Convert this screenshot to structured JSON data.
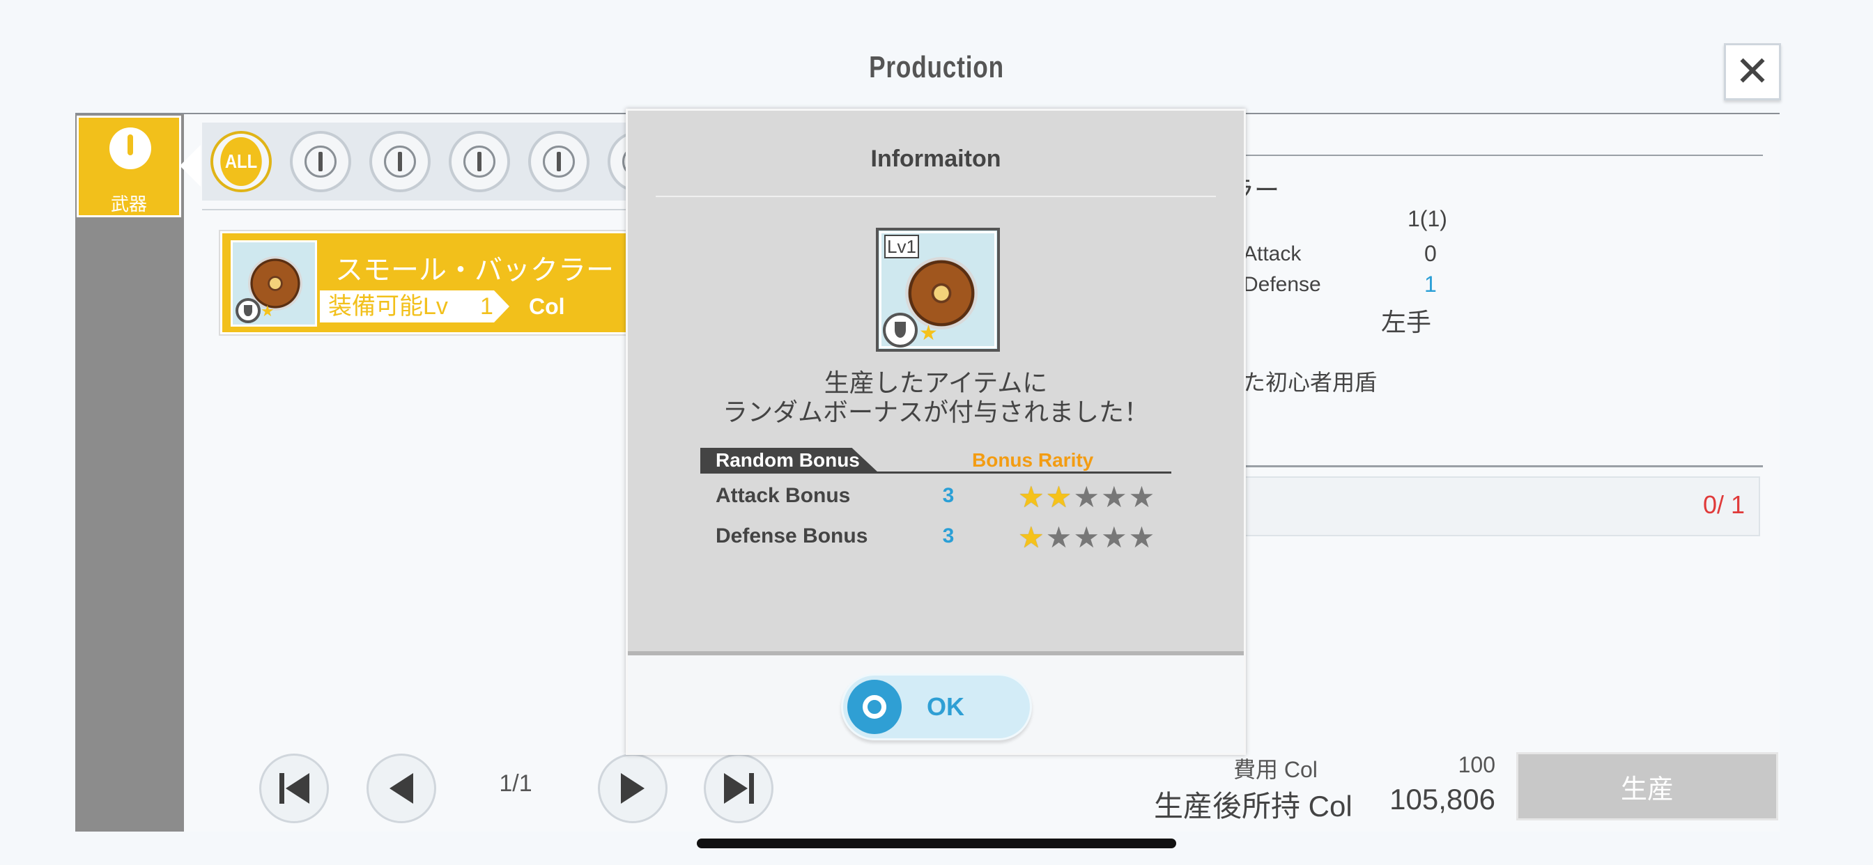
{
  "header": {
    "title": "Production"
  },
  "category_tab": {
    "label": "武器"
  },
  "filters": {
    "all_label": "ALL"
  },
  "item": {
    "name": "スモール・バックラー",
    "lv_label": "装備可能Lv",
    "lv_value": "1",
    "col_label": "Col"
  },
  "detail": {
    "name_fragment": "ラー",
    "count": "1(1)",
    "attack_label": "Attack",
    "attack_value": "0",
    "defense_label": "Defense",
    "defense_value": "1",
    "hand": "左手",
    "description_fragment": "た初心者用盾",
    "material_count": "0/  1"
  },
  "pager": {
    "page": "1/1"
  },
  "cost": {
    "label": "費用 Col",
    "value": "100",
    "after_label": "生産後所持 Col",
    "after_value": "105,806"
  },
  "produce_button": "生産",
  "modal": {
    "title": "Informaiton",
    "thumb_lv": "Lv1",
    "message_line1": "生産したアイテムに",
    "message_line2": "ランダムボーナスが付与されました！",
    "bonus_header": "Random Bonus",
    "rarity_header": "Bonus Rarity",
    "rows": [
      {
        "label": "Attack Bonus",
        "value": "3",
        "rarity": 2
      },
      {
        "label": "Defense Bonus",
        "value": "3",
        "rarity": 1
      }
    ],
    "ok_label": "OK"
  },
  "colors": {
    "accent": "#f2c01b",
    "ok_blue": "#2f9fd4",
    "red": "#e03a3a"
  }
}
